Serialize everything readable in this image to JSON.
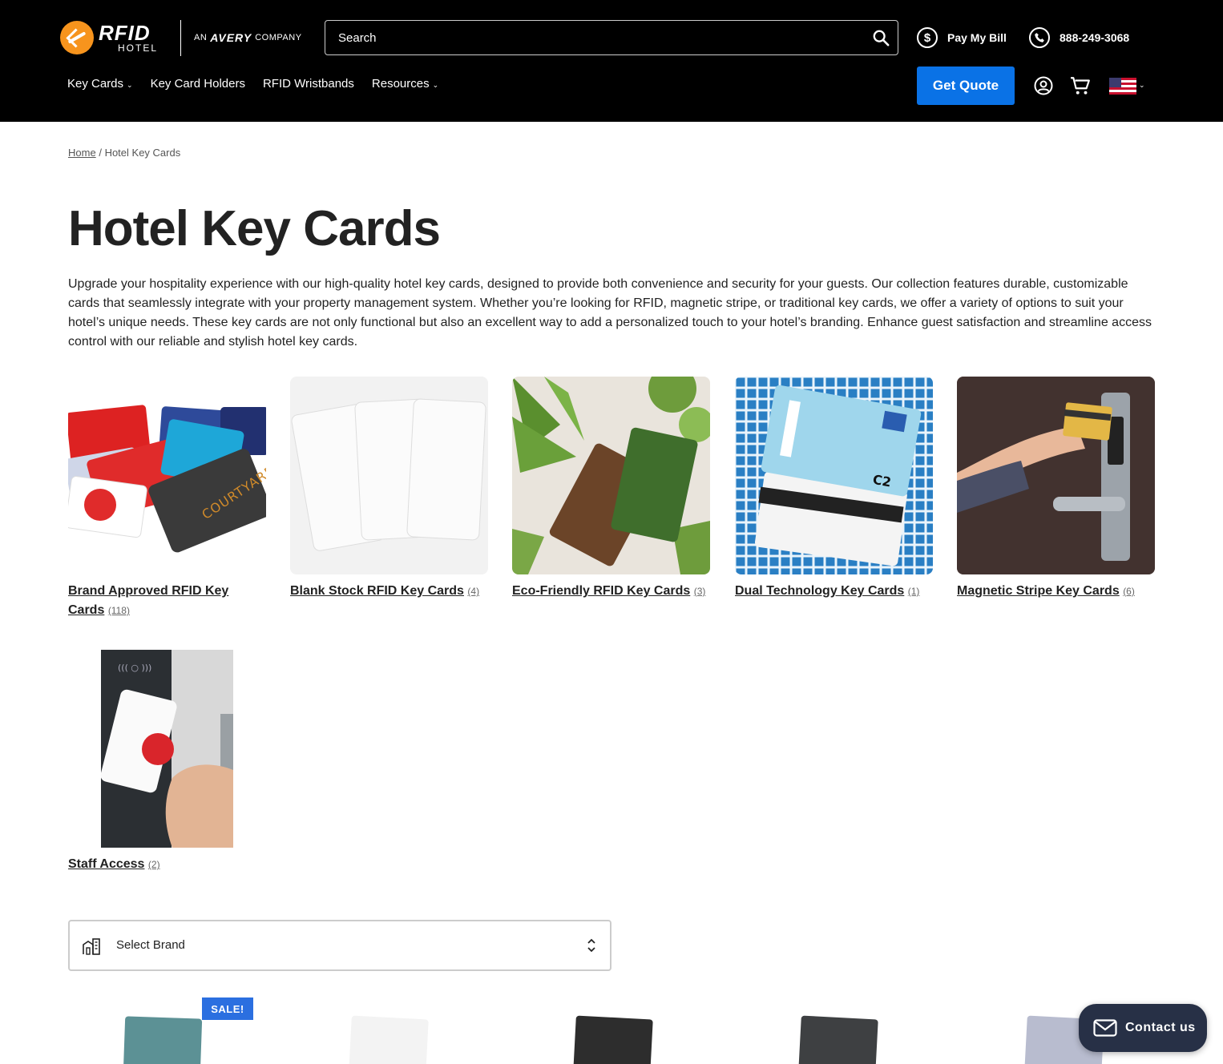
{
  "header": {
    "logo_brand": "RFID",
    "logo_sub": "HOTEL",
    "partner_prefix": "AN",
    "partner_name": "AVERY",
    "partner_suffix": "COMPANY",
    "search_placeholder": "Search",
    "pay_bill": "Pay My Bill",
    "phone": "888-249-3068",
    "quote_button": "Get Quote",
    "nav": [
      {
        "label": "Key Cards",
        "has_dropdown": true
      },
      {
        "label": "Key Card Holders",
        "has_dropdown": false
      },
      {
        "label": "RFID Wristbands",
        "has_dropdown": false
      },
      {
        "label": "Resources",
        "has_dropdown": true
      }
    ],
    "locale_flag": "us-flag-icon"
  },
  "breadcrumb": {
    "home": "Home",
    "separator": "/",
    "current": "Hotel Key Cards"
  },
  "page": {
    "title": "Hotel Key Cards",
    "intro": "Upgrade your hospitality experience with our high-quality hotel key cards, designed to provide both convenience and security for your guests. Our collection features durable, customizable cards that seamlessly integrate with your property management system. Whether you’re looking for RFID, magnetic stripe, or traditional key cards, we offer a variety of options to suit your hotel’s unique needs. These key cards are not only functional but also an excellent way to add a personalized touch to your hotel’s branding. Enhance guest satisfaction and streamline access control with our reliable and stylish hotel key cards."
  },
  "categories": [
    {
      "name": "Brand Approved RFID Key Cards",
      "count": "(118)"
    },
    {
      "name": "Blank Stock RFID Key Cards",
      "count": "(4)"
    },
    {
      "name": "Eco-Friendly RFID Key Cards",
      "count": "(3)"
    },
    {
      "name": "Dual Technology Key Cards",
      "count": "(1)"
    },
    {
      "name": "Magnetic Stripe Key Cards",
      "count": "(6)"
    },
    {
      "name": "Staff Access",
      "count": "(2)"
    }
  ],
  "filter": {
    "select_brand": "Select Brand"
  },
  "products": {
    "sale_badge": "SALE!"
  },
  "contact": {
    "label": "Contact us"
  },
  "colors": {
    "accent": "#0a72e6",
    "header_bg": "#000000",
    "sale": "#2b6fe0",
    "contact_bg": "#273046"
  }
}
